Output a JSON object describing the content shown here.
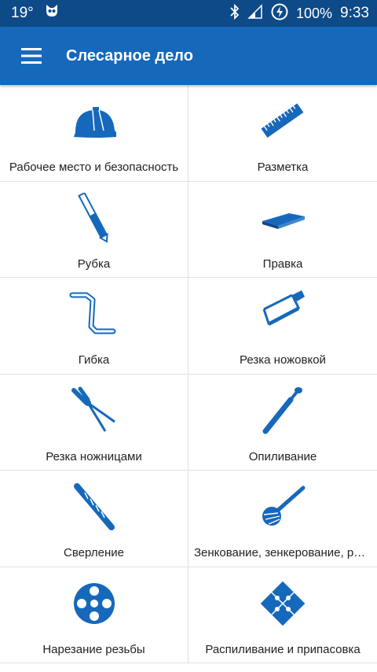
{
  "status_bar": {
    "temperature": "19°",
    "battery": "100%",
    "time": "9:33"
  },
  "app_bar": {
    "title": "Слесарное дело",
    "menu_icon": "hamburger-icon"
  },
  "colors": {
    "accent": "#1668bb",
    "status_bar": "#0d4a87",
    "icon": "#1668bb"
  },
  "topics": [
    {
      "label": "Рабочее место и безопасность",
      "icon": "hard-hat-icon"
    },
    {
      "label": "Разметка",
      "icon": "ruler-icon"
    },
    {
      "label": "Рубка",
      "icon": "chisel-icon"
    },
    {
      "label": "Правка",
      "icon": "anvil-plate-icon"
    },
    {
      "label": "Гибка",
      "icon": "bent-rod-icon"
    },
    {
      "label": "Резка ножовкой",
      "icon": "hacksaw-icon"
    },
    {
      "label": "Резка ножницами",
      "icon": "shears-icon"
    },
    {
      "label": "Опиливание",
      "icon": "file-icon"
    },
    {
      "label": "Сверление",
      "icon": "drill-bit-icon"
    },
    {
      "label": "Зенкование, зенкерование, развертывание",
      "icon": "countersink-icon"
    },
    {
      "label": "Нарезание резьбы",
      "icon": "thread-die-icon"
    },
    {
      "label": "Распиливание и припасовка",
      "icon": "puzzle-icon"
    }
  ]
}
